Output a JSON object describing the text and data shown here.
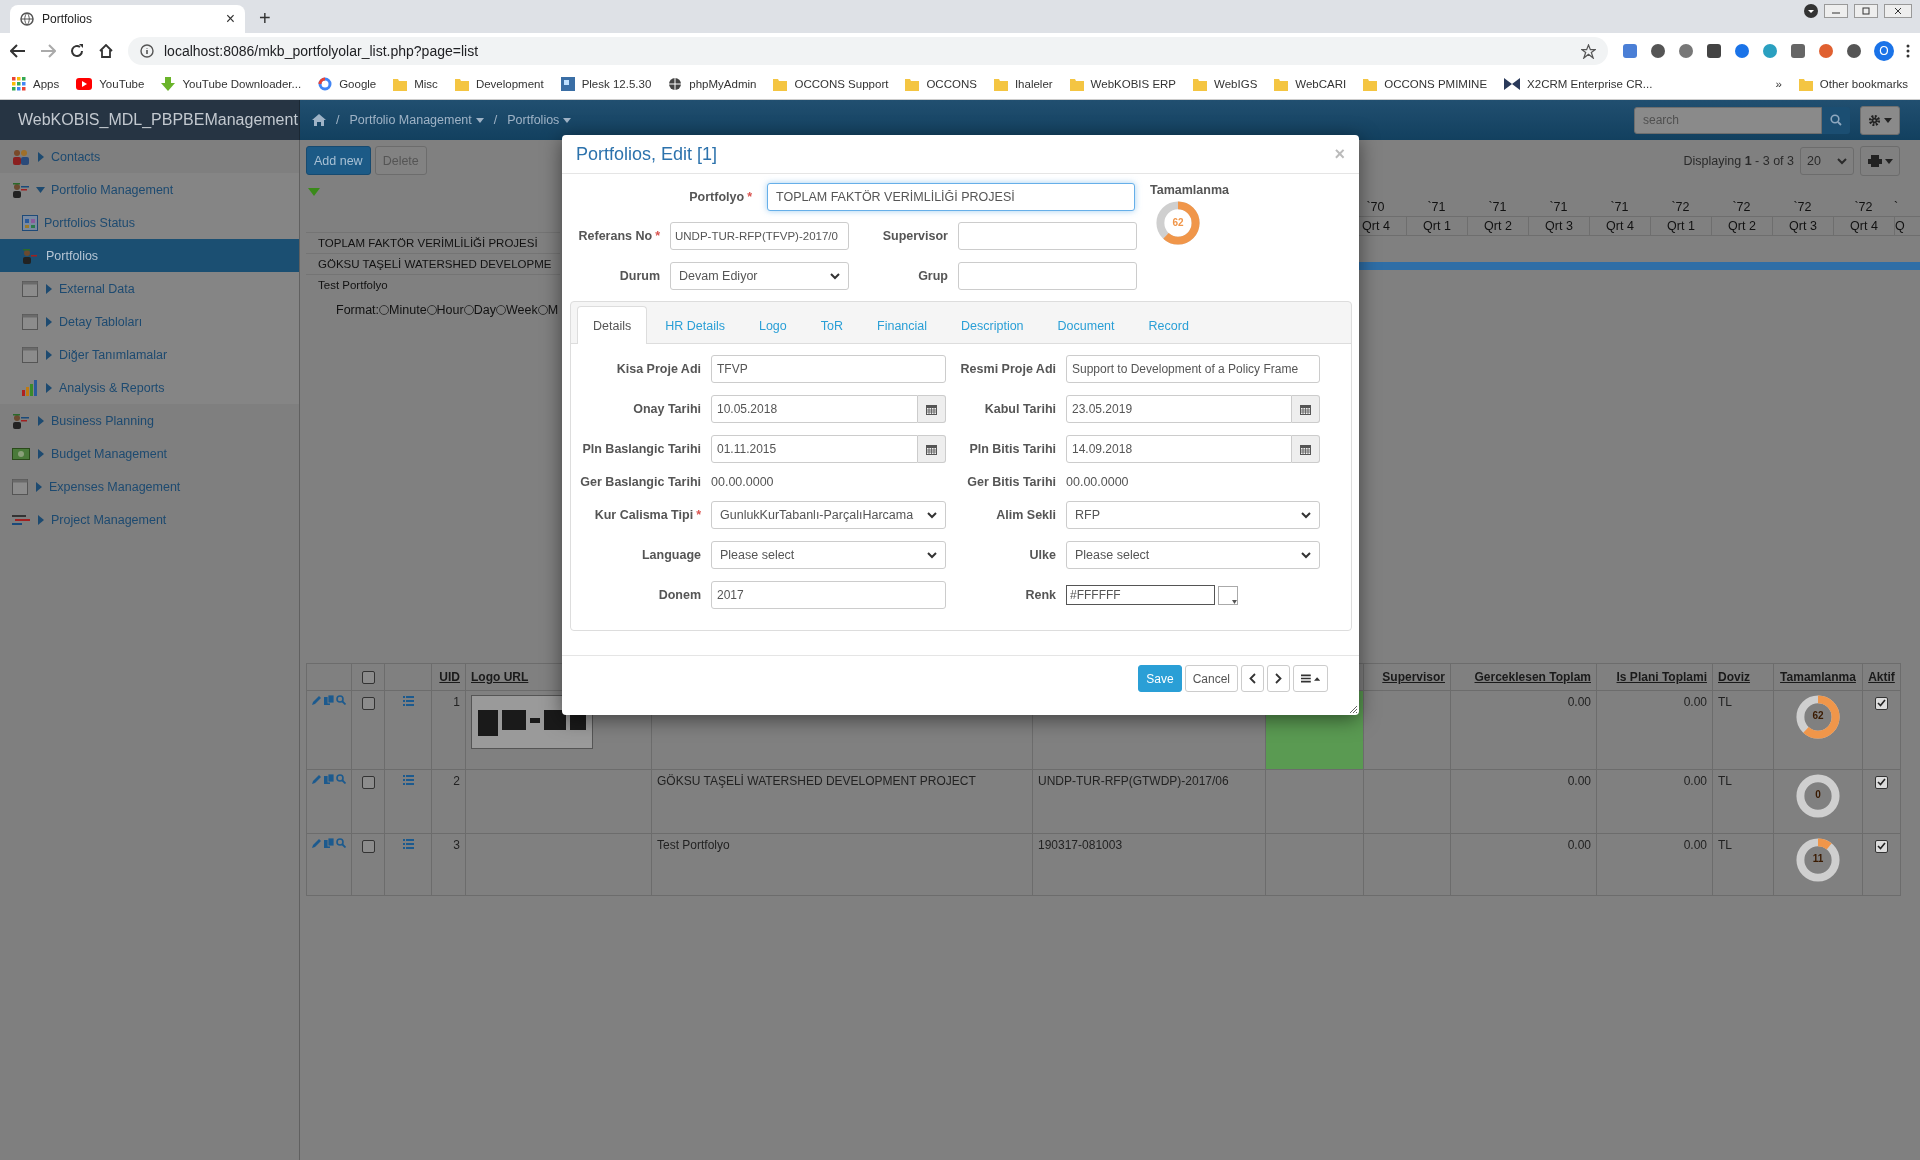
{
  "browser": {
    "tab_title": "Portfolios",
    "tab_close": "×",
    "new_tab": "+",
    "url": "localhost:8086/mkb_portfolyolar_list.php?page=list",
    "profile": "O",
    "bookmarks": [
      {
        "label": "Apps",
        "kind": "apps"
      },
      {
        "label": "YouTube",
        "kind": "youtube"
      },
      {
        "label": "YouTube Downloader...",
        "kind": "download"
      },
      {
        "label": "Google",
        "kind": "google"
      },
      {
        "label": "Misc",
        "kind": "folder"
      },
      {
        "label": "Development",
        "kind": "folder"
      },
      {
        "label": "Plesk 12.5.30",
        "kind": "plesk"
      },
      {
        "label": "phpMyAdmin",
        "kind": "globe"
      },
      {
        "label": "OCCONS Support",
        "kind": "folder"
      },
      {
        "label": "OCCONS",
        "kind": "folder"
      },
      {
        "label": "Ihaleler",
        "kind": "folder"
      },
      {
        "label": "WebKOBIS ERP",
        "kind": "folder"
      },
      {
        "label": "WebIGS",
        "kind": "folder"
      },
      {
        "label": "WebCARI",
        "kind": "folder"
      },
      {
        "label": "OCCONS PMIMINE",
        "kind": "folder"
      },
      {
        "label": "X2CRM Enterprise CR...",
        "kind": "crm"
      }
    ],
    "more": "»",
    "other_bookmarks": "Other bookmarks"
  },
  "app": {
    "brand": "WebKOBIS_MDL_PBPBEManagement",
    "breadcrumb": [
      {
        "separator": "/",
        "label": "Portfolio Management"
      },
      {
        "separator": "/",
        "label": "Portfolios"
      }
    ],
    "search": {
      "placeholder": "search"
    }
  },
  "sidebar": {
    "items": [
      {
        "label": "Contacts",
        "kind": "people",
        "expanded": false,
        "selected": false
      },
      {
        "label": "Portfolio Management",
        "kind": "manager",
        "expanded": true,
        "selected": false,
        "children": [
          {
            "label": "Portfolios Status",
            "kind": "dashboard",
            "selected": false
          },
          {
            "label": "Portfolios",
            "kind": "manager",
            "selected": true
          },
          {
            "label": "External Data",
            "kind": "window",
            "expanded": false,
            "selected": false
          },
          {
            "label": "Detay Tabloları",
            "kind": "window",
            "expanded": false,
            "selected": false
          },
          {
            "label": "Diğer Tanımlamalar",
            "kind": "window",
            "expanded": false,
            "selected": false
          },
          {
            "label": "Analysis & Reports",
            "kind": "chart",
            "expanded": false,
            "selected": false
          }
        ]
      },
      {
        "label": "Business Planning",
        "kind": "manager",
        "expanded": false,
        "selected": false
      },
      {
        "label": "Budget Management",
        "kind": "money",
        "expanded": false,
        "selected": false
      },
      {
        "label": "Expenses Management",
        "kind": "window",
        "expanded": false,
        "selected": false
      },
      {
        "label": "Project Management",
        "kind": "lines",
        "expanded": false,
        "selected": false
      }
    ]
  },
  "toolbar": {
    "buttons": [
      {
        "label": "Add new",
        "kind": "primary"
      },
      {
        "label": "Delete",
        "kind": "default"
      }
    ],
    "paging": "Displaying **1** - 3 of 3",
    "page_size": "20"
  },
  "list_rows": [
    "TOPLAM FAKTÖR VERİMLİLİĞİ PROJESİ",
    "GÖKSU TAŞELİ WATERSHED DEVELOPME",
    "Test Portfolyo"
  ],
  "format": {
    "label": "Format:",
    "options": [
      {
        "label": "Minute",
        "selected": false
      },
      {
        "label": "Hour",
        "selected": false
      },
      {
        "label": "Day",
        "selected": false
      },
      {
        "label": "Week",
        "selected": false
      },
      {
        "label": "M",
        "selected": false
      }
    ]
  },
  "timeline": {
    "columns": [
      {
        "year": "`70",
        "quarter": "Qrt 4"
      },
      {
        "year": "`71",
        "quarter": "Qrt 1"
      },
      {
        "year": "`71",
        "quarter": "Qrt 2"
      },
      {
        "year": "`71",
        "quarter": "Qrt 3"
      },
      {
        "year": "`71",
        "quarter": "Qrt 4"
      },
      {
        "year": "`72",
        "quarter": "Qrt 1"
      },
      {
        "year": "`72",
        "quarter": "Qrt 2"
      },
      {
        "year": "`72",
        "quarter": "Qrt 3"
      },
      {
        "year": "`72",
        "quarter": "Qrt 4"
      },
      {
        "year": "`",
        "quarter": "Q"
      }
    ]
  },
  "table": {
    "select_all_checked": false,
    "header": {
      "uid": "UID",
      "logo_url": "Logo URL",
      "supervisor": "Supervisor",
      "actual_total": "Gerceklesen Toplam",
      "plan_total": "Is Plani Toplami",
      "currency": "Doviz",
      "completion": "Tamamlanma",
      "active": "Aktif"
    },
    "rows": [
      {
        "uid": "1",
        "selected": false,
        "color": "#5a9a52",
        "actual_total": "0.00",
        "plan_total": "0.00",
        "currency": "TL",
        "completion": "62",
        "level": 0.62,
        "active": true
      },
      {
        "uid": "2",
        "selected": false,
        "name": "GÖKSU TAŞELİ WATERSHED DEVELOPMENT PROJECT",
        "reference": "UNDP-TUR-RFP(GTWDP)-2017/06",
        "actual_total": "0.00",
        "plan_total": "0.00",
        "currency": "TL",
        "completion": "0",
        "level": 0,
        "active": true
      },
      {
        "uid": "3",
        "selected": false,
        "name": "Test Portfolyo",
        "reference": "190317-081003",
        "actual_total": "0.00",
        "plan_total": "0.00",
        "currency": "TL",
        "completion": "11",
        "level": 0.11,
        "active": true
      }
    ]
  },
  "modal": {
    "title": "Portfolios, Edit [1]",
    "close": "×",
    "portfolyo": {
      "label": "Portfolyo",
      "required_mark": "*",
      "value": "TOPLAM FAKTÖR VERİMLİLİĞİ PROJESİ"
    },
    "referans": {
      "label": "Referans No",
      "required_mark": "*",
      "value": "UNDP-TUR-RFP(TFVP)-2017/0"
    },
    "supervisor": {
      "label": "Supervisor"
    },
    "durum": {
      "label": "Durum",
      "value": "Devam Ediyor"
    },
    "grup": {
      "label": "Grup"
    },
    "completion": {
      "label": "Tamamlanma",
      "value": "62",
      "level": 0.62
    },
    "tabs": [
      {
        "label": "Details",
        "selected": true
      },
      {
        "label": "HR Details",
        "selected": false
      },
      {
        "label": "Logo",
        "selected": false
      },
      {
        "label": "ToR",
        "selected": false
      },
      {
        "label": "Financial",
        "selected": false
      },
      {
        "label": "Description",
        "selected": false
      },
      {
        "label": "Document",
        "selected": false
      },
      {
        "label": "Record",
        "selected": false
      }
    ],
    "fields": [
      {
        "label": "Kisa Proje Adi",
        "kind": "text",
        "value": "TFVP"
      },
      {
        "label": "Resmi Proje Adi",
        "kind": "text",
        "value": "Support to Development of a Policy Frame"
      },
      {
        "label": "Onay Tarihi",
        "kind": "date",
        "value": "10.05.2018"
      },
      {
        "label": "Kabul Tarihi",
        "kind": "date",
        "value": "23.05.2019"
      },
      {
        "label": "Pln Baslangic Tarihi",
        "kind": "date",
        "value": "01.11.2015"
      },
      {
        "label": "Pln Bitis Tarihi",
        "kind": "date",
        "value": "14.09.2018"
      },
      {
        "label": "Ger Baslangic Tarihi",
        "kind": "static",
        "value": "00.00.0000"
      },
      {
        "label": "Ger Bitis Tarihi",
        "kind": "static",
        "value": "00.00.0000"
      },
      {
        "label": "Kur Calisma Tipi",
        "kind": "select",
        "required_mark": "*",
        "value": "GunlukKurTabanlı-ParçalıHarcama"
      },
      {
        "label": "Alim Sekli",
        "kind": "select",
        "value": "RFP"
      },
      {
        "label": "Language",
        "kind": "select",
        "value": "Please select"
      },
      {
        "label": "Ulke",
        "kind": "select",
        "value": "Please select"
      },
      {
        "label": "Donem",
        "kind": "text",
        "value": "2017"
      },
      {
        "label": "Renk",
        "kind": "color",
        "value": "#FFFFFF",
        "color": "#ffffff"
      }
    ],
    "buttons": [
      {
        "label": "Save",
        "kind": "primary"
      },
      {
        "label": "Cancel",
        "kind": "default"
      }
    ]
  }
}
